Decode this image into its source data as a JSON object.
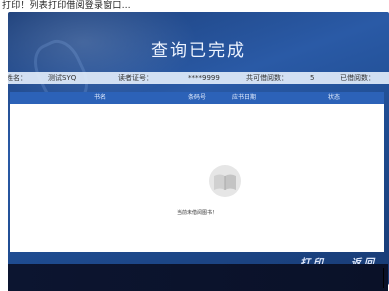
{
  "caption": "打印！列表打印借阅登录窗口…",
  "title": "查询已完成",
  "info": {
    "name_label": "姓名：",
    "name_value": "测试SYQ",
    "card_label": "读者证号：",
    "card_value": "****9999",
    "canborrow_label": "共可借阅数：",
    "canborrow_value": "5",
    "borrowed_label": "已借阅数："
  },
  "table": {
    "columns": [
      "书名",
      "条码号",
      "应书日期",
      "状态"
    ]
  },
  "empty_text": "当前未借阅图书！",
  "buttons": {
    "print": "打印",
    "back": "返回"
  },
  "colors": {
    "screen_blue": "#2a5aa6",
    "header_blue": "#2c62b8",
    "icon_gray": "#d8d8d8"
  },
  "icons": {
    "empty_state": "book-icon"
  }
}
